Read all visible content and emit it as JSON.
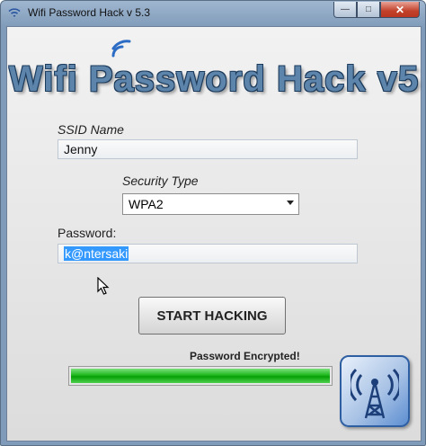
{
  "window": {
    "title": "Wifi Password Hack v 5.3",
    "controls": {
      "minimize": "—",
      "maximize": "□",
      "close": "✕"
    }
  },
  "app": {
    "heading": "Wifi Password Hack v5",
    "accent_color": "#5d84aa"
  },
  "form": {
    "ssid_label": "SSID Name",
    "ssid_value": "Jenny",
    "security_label": "Security Type",
    "security_value": "WPA2",
    "password_label": "Password:",
    "password_value": "k@ntersaki"
  },
  "actions": {
    "start_label": "START HACKING"
  },
  "status": {
    "text": "Password Encrypted!",
    "progress_percent": 100,
    "progress_color": "#1fb81f"
  },
  "icons": {
    "app_icon": "wifi-signal-icon",
    "corner_icon": "antenna-tower-icon",
    "cursor": "mouse-pointer-icon"
  }
}
